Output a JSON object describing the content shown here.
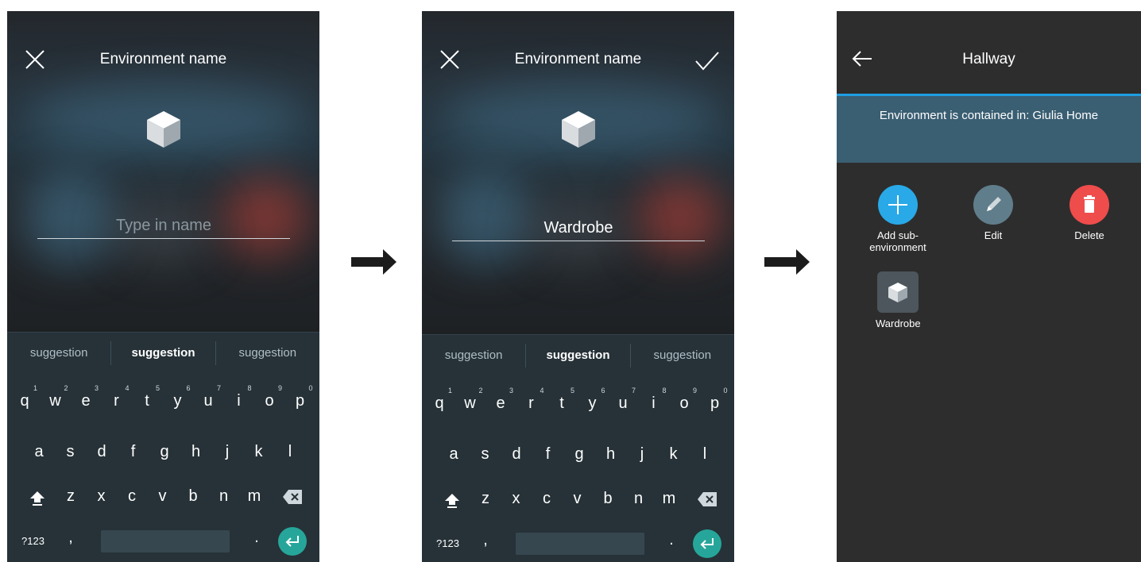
{
  "screen1": {
    "title": "Environment name",
    "input_value": "",
    "input_placeholder": "Type in name",
    "suggestions": [
      "suggestion",
      "suggestion",
      "suggestion"
    ]
  },
  "screen2": {
    "title": "Environment name",
    "input_value": "Wardrobe",
    "input_placeholder": "",
    "suggestions": [
      "suggestion",
      "suggestion",
      "suggestion"
    ]
  },
  "keyboard": {
    "row1": [
      "q",
      "w",
      "e",
      "r",
      "t",
      "y",
      "u",
      "i",
      "o",
      "p"
    ],
    "row1_hints": [
      "1",
      "2",
      "3",
      "4",
      "5",
      "6",
      "7",
      "8",
      "9",
      "0"
    ],
    "row2": [
      "a",
      "s",
      "d",
      "f",
      "g",
      "h",
      "j",
      "k",
      "l"
    ],
    "row3": [
      "z",
      "x",
      "c",
      "v",
      "b",
      "n",
      "m"
    ],
    "symbols_label": "?123",
    "comma": ",",
    "period": "."
  },
  "screen3": {
    "title": "Hallway",
    "info": "Environment is contained in: Giulia Home",
    "actions": {
      "add": "Add sub-\nenvironment",
      "edit": "Edit",
      "delete": "Delete"
    },
    "sub_environment": "Wardrobe"
  },
  "colors": {
    "accent_blue": "#1e9ee3",
    "add_blue": "#29a9e8",
    "edit_gray": "#607d8b",
    "delete_red": "#ef4c4c",
    "enter_teal": "#26a69a",
    "info_band": "#3a5e72"
  },
  "icons": [
    "close-icon",
    "check-icon",
    "cube-icon",
    "shift-icon",
    "backspace-icon",
    "enter-icon",
    "back-arrow-icon",
    "plus-icon",
    "pencil-icon",
    "trash-icon",
    "right-arrow-icon"
  ]
}
